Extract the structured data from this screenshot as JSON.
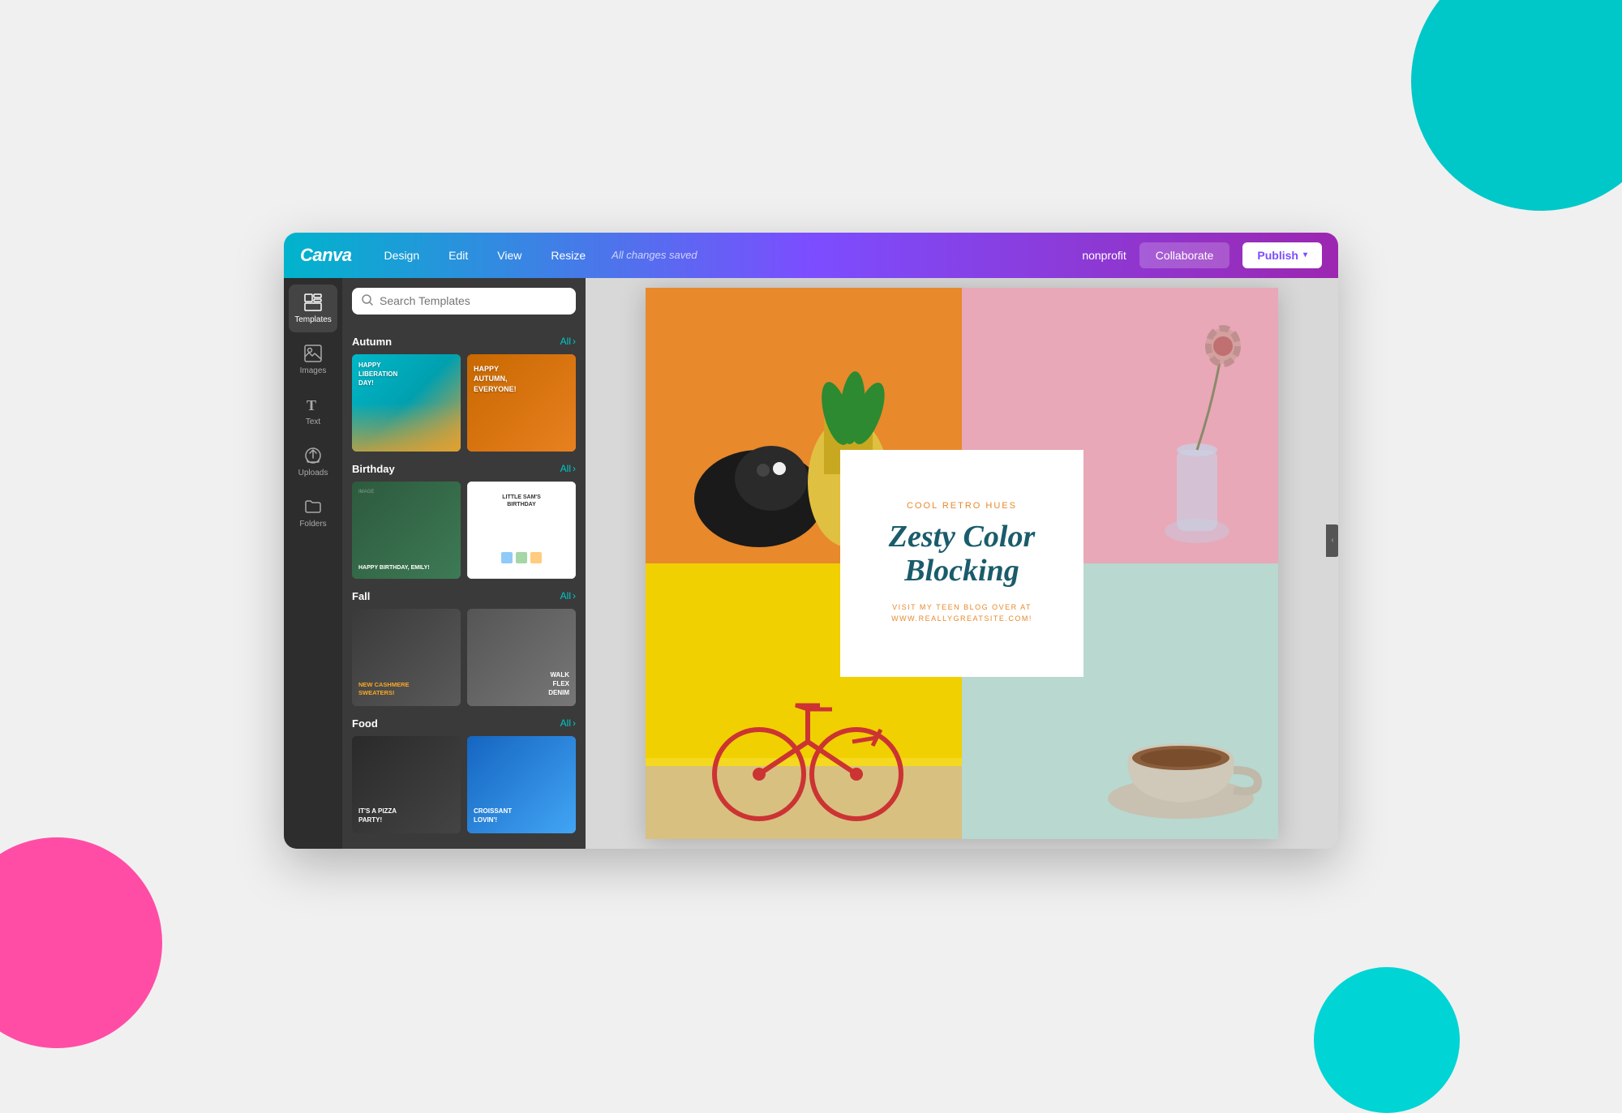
{
  "app": {
    "name": "Canva",
    "status": "All changes saved"
  },
  "topbar": {
    "logo": "Canva",
    "nav": [
      {
        "label": "Design",
        "id": "design"
      },
      {
        "label": "Edit",
        "id": "edit"
      },
      {
        "label": "View",
        "id": "view"
      },
      {
        "label": "Resize",
        "id": "resize"
      }
    ],
    "status": "All changes saved",
    "nonprofit_label": "nonprofit",
    "collaborate_label": "Collaborate",
    "publish_label": "Publish"
  },
  "icon_sidebar": {
    "items": [
      {
        "id": "templates",
        "label": "Templates",
        "icon": "⊞",
        "active": true
      },
      {
        "id": "images",
        "label": "Images",
        "icon": "🖼"
      },
      {
        "id": "text",
        "label": "Text",
        "icon": "T"
      },
      {
        "id": "uploads",
        "label": "Uploads",
        "icon": "↑"
      },
      {
        "id": "folders",
        "label": "Folders",
        "icon": "📁"
      }
    ]
  },
  "templates_panel": {
    "search_placeholder": "Search Templates",
    "sections": [
      {
        "id": "autumn",
        "title": "Autumn",
        "all_label": "All",
        "cards": [
          {
            "id": "autumn1",
            "type": "tc-autumn1",
            "text": "HAPPY LIBERATION DAY!"
          },
          {
            "id": "autumn2",
            "type": "tc-autumn2",
            "text": "HAPPY AUTUMN, EVERYONE!"
          }
        ]
      },
      {
        "id": "birthday",
        "title": "Birthday",
        "all_label": "All",
        "cards": [
          {
            "id": "bday1",
            "type": "tc-bday1",
            "text": "HAPPY BIRTHDAY, EMILY!"
          },
          {
            "id": "bday2",
            "type": "tc-bday2",
            "text": "LITTLE SAM'S BIRTHDAY"
          }
        ]
      },
      {
        "id": "fall",
        "title": "Fall",
        "all_label": "All",
        "cards": [
          {
            "id": "fall1",
            "type": "tc-fall1",
            "text": "NEW CASHMERE SWEATERS!"
          },
          {
            "id": "fall2",
            "type": "tc-fall2",
            "text": "WALK FLEX DENIM"
          }
        ]
      },
      {
        "id": "food",
        "title": "Food",
        "all_label": "All",
        "cards": [
          {
            "id": "food1",
            "type": "tc-food1",
            "text": "IT'S A PIZZA PARTY!"
          },
          {
            "id": "food2",
            "type": "tc-food2",
            "text": "CROISSANT LOVIN'!"
          }
        ]
      }
    ]
  },
  "canvas": {
    "card": {
      "subtitle": "COOL RETRO HUES",
      "title": "Zesty Color Blocking",
      "body_line1": "VISIT MY TEEN BLOG OVER AT",
      "body_line2": "WWW.REALLYGREATSITE.COM!"
    }
  },
  "colors": {
    "teal": "#00b4cc",
    "purple": "#7c4dff",
    "pink": "#ff4da6",
    "orange": "#e8892c",
    "yellow": "#f5e642",
    "teal_light": "#b8d8d0",
    "title_color": "#1a5c6b"
  }
}
